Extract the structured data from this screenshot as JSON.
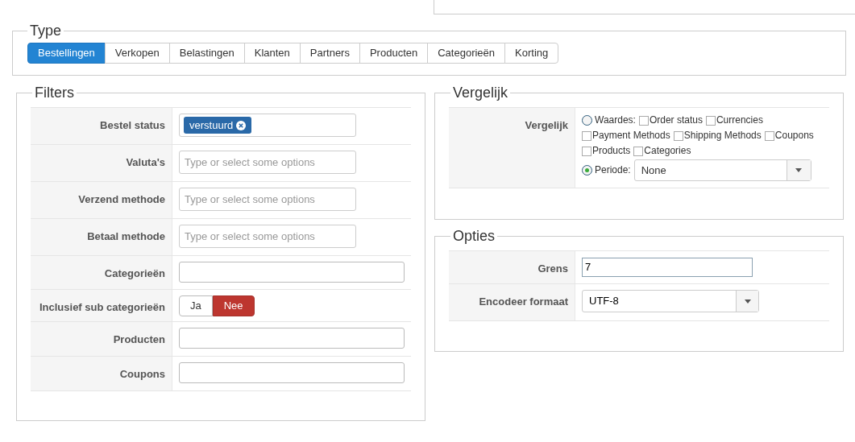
{
  "type": {
    "title": "Type",
    "tabs": [
      {
        "label": "Bestellingen",
        "selected": true
      },
      {
        "label": "Verkopen",
        "selected": false
      },
      {
        "label": "Belastingen",
        "selected": false
      },
      {
        "label": "Klanten",
        "selected": false
      },
      {
        "label": "Partners",
        "selected": false
      },
      {
        "label": "Producten",
        "selected": false
      },
      {
        "label": "Categorieën",
        "selected": false
      },
      {
        "label": "Korting",
        "selected": false
      }
    ]
  },
  "filters": {
    "title": "Filters",
    "rows": [
      {
        "kind": "tags",
        "label": "Bestel status",
        "tags": [
          "verstuurd"
        ]
      },
      {
        "kind": "multiselect",
        "label": "Valuta's",
        "placeholder": "Type or select some options"
      },
      {
        "kind": "multiselect",
        "label": "Verzend methode",
        "placeholder": "Type or select some options"
      },
      {
        "kind": "multiselect",
        "label": "Betaal methode",
        "placeholder": "Type or select some options"
      },
      {
        "kind": "text",
        "label": "Categorieën"
      },
      {
        "kind": "toggle",
        "label": "Inclusief sub categorieën",
        "options": [
          {
            "label": "Ja",
            "selected": false
          },
          {
            "label": "Nee",
            "selected": true
          }
        ]
      },
      {
        "kind": "text",
        "label": "Producten"
      },
      {
        "kind": "text",
        "label": "Coupons"
      }
    ]
  },
  "vergelijk": {
    "title": "Vergelijk",
    "label": "Vergelijk",
    "values_option": {
      "label": "Waardes:",
      "selected": false,
      "checkboxes": [
        {
          "label": "Order status",
          "checked": false
        },
        {
          "label": "Currencies",
          "checked": false
        },
        {
          "label": "Payment Methods",
          "checked": false
        },
        {
          "label": "Shipping Methods",
          "checked": false
        },
        {
          "label": "Coupons",
          "checked": false
        },
        {
          "label": "Products",
          "checked": false
        },
        {
          "label": "Categories",
          "checked": false
        }
      ]
    },
    "period_option": {
      "label": "Periode:",
      "selected": true,
      "value": "None"
    }
  },
  "opties": {
    "title": "Opties",
    "rows": [
      {
        "kind": "text",
        "label": "Grens",
        "value": "7"
      },
      {
        "kind": "select",
        "label": "Encodeer formaat",
        "value": "UTF-8"
      }
    ]
  }
}
